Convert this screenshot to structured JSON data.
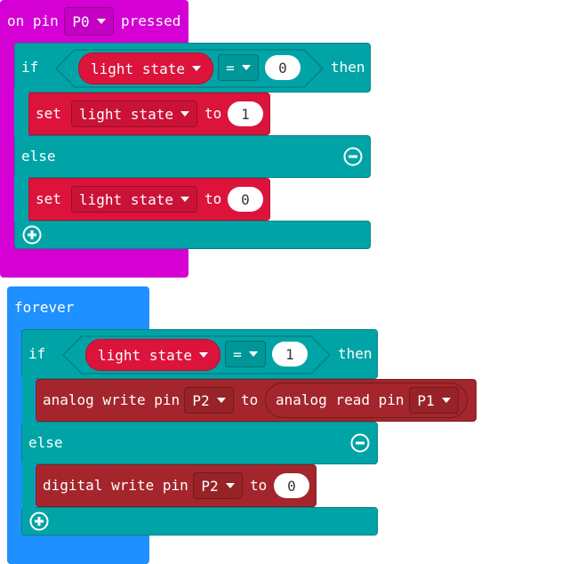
{
  "event_block": {
    "prefix": "on pin",
    "pin": "P0",
    "suffix": "pressed",
    "if_keyword": "if",
    "condition": {
      "variable": "light state",
      "operator": "=",
      "value": "0"
    },
    "then_keyword": "then",
    "then_action": {
      "keyword": "set",
      "variable": "light state",
      "to": "to",
      "value": "1"
    },
    "else_keyword": "else",
    "else_action": {
      "keyword": "set",
      "variable": "light state",
      "to": "to",
      "value": "0"
    }
  },
  "forever_block": {
    "label": "forever",
    "if_keyword": "if",
    "condition": {
      "variable": "light state",
      "operator": "=",
      "value": "1"
    },
    "then_keyword": "then",
    "then_action": {
      "label": "analog write pin",
      "pin": "P2",
      "to": "to",
      "reporter_label": "analog read pin",
      "reporter_pin": "P1"
    },
    "else_keyword": "else",
    "else_action": {
      "label": "digital write pin",
      "pin": "P2",
      "to": "to",
      "value": "0"
    }
  },
  "colors": {
    "input_category": "#d400d4",
    "basic_category": "#1e90ff",
    "logic_category": "#00a4a6",
    "variables_category": "#dc143c",
    "pins_category": "#a4262c"
  },
  "icons": [
    "minus-circle-icon",
    "plus-circle-icon",
    "dropdown-caret-icon"
  ]
}
